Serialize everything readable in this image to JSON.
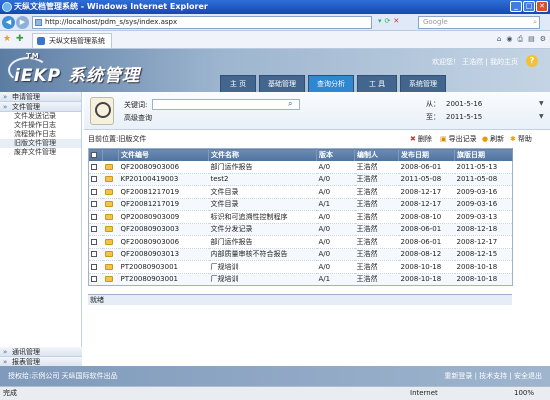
{
  "window": {
    "title": "天纵文档管理系统 - Windows Internet Explorer"
  },
  "browser": {
    "url": "http://localhost/pdm_s/sys/index.aspx",
    "search_placeholder": "Google",
    "tab_title": "天纵文档管理系统",
    "status_left": "完成",
    "zone": "Internet",
    "zoom": "100%"
  },
  "header": {
    "logo": "iEKP 系统管理",
    "logo_tm": "TM",
    "welcome": "欢迎您！ 王浩然  | 我的主页",
    "nav": [
      {
        "label": "主  页"
      },
      {
        "label": "基础管理"
      },
      {
        "label": "查询分析"
      },
      {
        "label": "工  具"
      },
      {
        "label": "系统管理"
      }
    ]
  },
  "sidebar": {
    "sections": [
      {
        "label": "申请管理"
      },
      {
        "label": "文件管理"
      }
    ],
    "items": [
      {
        "label": "文件发送记录"
      },
      {
        "label": "文件操作日志"
      },
      {
        "label": "流程操作日志"
      },
      {
        "label": "旧版文件管理"
      },
      {
        "label": "废弃文件管理"
      }
    ],
    "bottom": [
      {
        "label": "通讯管理"
      },
      {
        "label": "报表管理"
      }
    ]
  },
  "search": {
    "keyword_label": "关键词:",
    "advanced": "高级查询",
    "from_label": "从：",
    "from_value": "2001-5-16",
    "to_label": "至：",
    "to_value": "2011-5-15"
  },
  "toolbar": {
    "location": "目前位置:旧版文件",
    "delete": "删除",
    "export": "导出记录",
    "refresh": "刷新",
    "help": "帮助"
  },
  "table": {
    "headers": [
      "",
      "",
      "文件编号",
      "文件名称",
      "版本",
      "编制人",
      "发布日期",
      "旗版日期"
    ],
    "rows": [
      [
        "QF20080903006",
        "部门运作报告",
        "A/0",
        "王浩然",
        "2008-06-01",
        "2011-05-13"
      ],
      [
        "KP20100419003",
        "test2",
        "A/0",
        "王浩然",
        "2011-05-08",
        "2011-05-08"
      ],
      [
        "QF20081217019",
        "文件目录",
        "A/0",
        "王浩然",
        "2008-12-17",
        "2009-03-16"
      ],
      [
        "QF20081217019",
        "文件目录",
        "A/1",
        "王浩然",
        "2008-12-17",
        "2009-03-16"
      ],
      [
        "QP20080903009",
        "标识和可追溯性控制程序",
        "A/0",
        "王浩然",
        "2008-08-10",
        "2009-03-13"
      ],
      [
        "QF20080903003",
        "文件分发记录",
        "A/0",
        "王浩然",
        "2008-06-01",
        "2008-12-18"
      ],
      [
        "QF20080903006",
        "部门运作报告",
        "A/0",
        "王浩然",
        "2008-06-01",
        "2008-12-17"
      ],
      [
        "QF20080903013",
        "内部质量审核不符合报告",
        "A/0",
        "王浩然",
        "2008-08-12",
        "2008-12-15"
      ],
      [
        "PT20080903001",
        "厂规培训",
        "A/0",
        "王浩然",
        "2008-10-18",
        "2008-10-18"
      ],
      [
        "PT20080903001",
        "厂规培训",
        "A/1",
        "王浩然",
        "2008-10-18",
        "2008-10-18"
      ]
    ],
    "status": "就绪"
  },
  "footer": {
    "left": "授权给:示例公司   天纵国际软件出品",
    "right": "重新登录 | 技术支持 | 安全退出"
  },
  "colors": {
    "nav_active": "#2f86d1",
    "header_start": "#5c7da3",
    "grid_header": "#5f80aa"
  }
}
